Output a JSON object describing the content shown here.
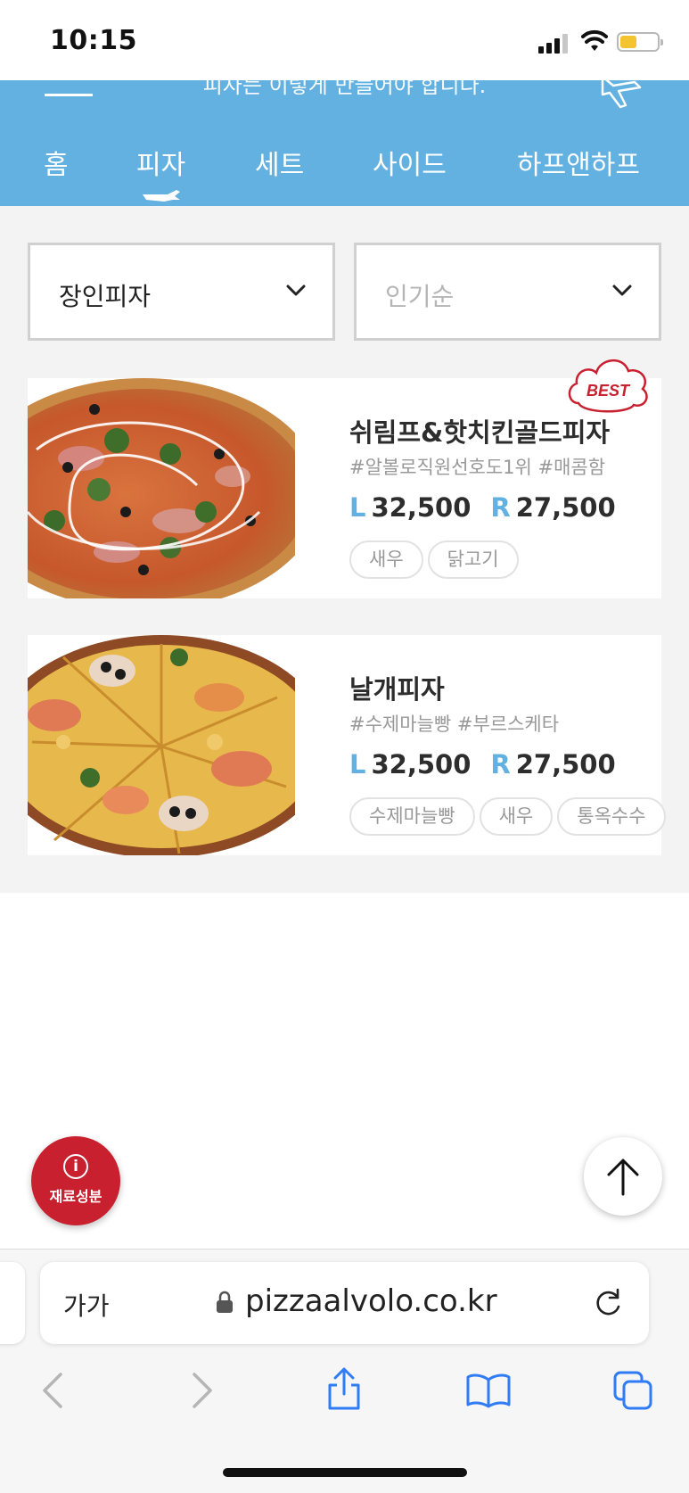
{
  "status_bar": {
    "time": "10:15"
  },
  "header": {
    "slogan": "피자는 이렇게 만들어야 합니다.",
    "nav": [
      {
        "label": "홈"
      },
      {
        "label": "피자"
      },
      {
        "label": "세트"
      },
      {
        "label": "사이드"
      },
      {
        "label": "하프앤하프"
      }
    ],
    "active_nav": "피자",
    "color": "#62b1e0"
  },
  "filters": {
    "category": {
      "value": "장인피자"
    },
    "sort": {
      "placeholder": "인기순"
    }
  },
  "products": [
    {
      "badge": "BEST",
      "name": "쉬림프&핫치킨골드피자",
      "tags": "#알볼로직원선호도1위 #매콤함",
      "price_l_label": "L",
      "price_l": "32,500",
      "price_r_label": "R",
      "price_r": "27,500",
      "chips": [
        "새우",
        "닭고기"
      ]
    },
    {
      "name": "날개피자",
      "tags": "#수제마늘빵 #부르스케타",
      "price_l_label": "L",
      "price_l": "32,500",
      "price_r_label": "R",
      "price_r": "27,500",
      "chips": [
        "수제마늘빵",
        "새우",
        "통옥수수"
      ]
    }
  ],
  "floating": {
    "info_label": "재료성분",
    "info_icon": "i"
  },
  "browser": {
    "text_size": "가가",
    "url": "pizzaalvolo.co.kr"
  },
  "colors": {
    "accent": "#62b1e0",
    "badge_red": "#c8202f"
  }
}
